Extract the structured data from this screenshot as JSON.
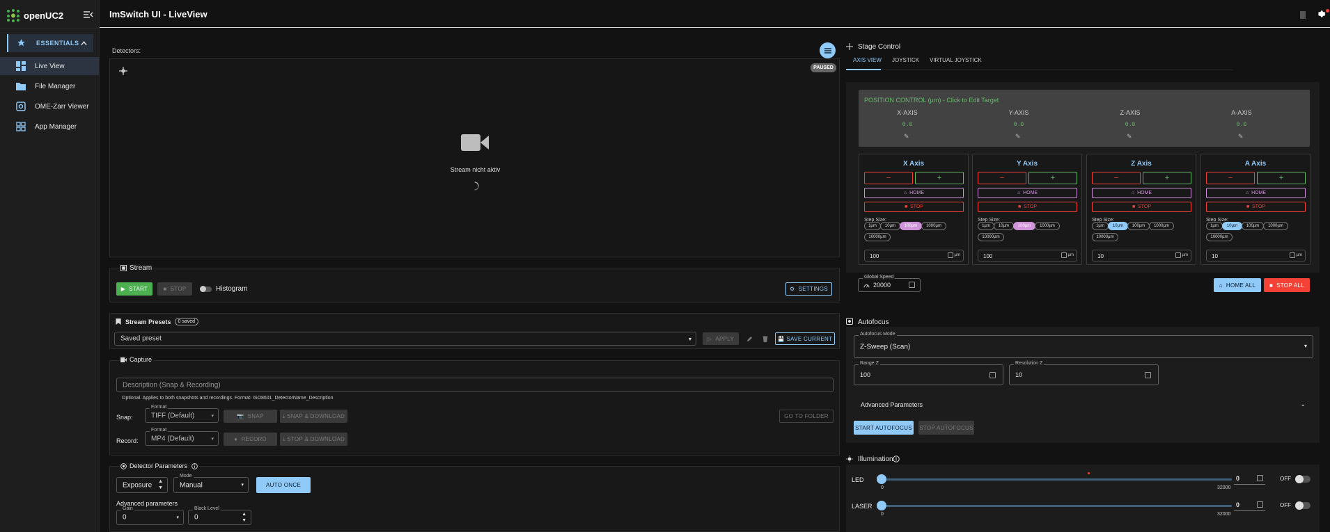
{
  "app": {
    "brand": "openUC2",
    "title": "ImSwitch UI - LiveView"
  },
  "sidebar": {
    "section_label": "ESSENTIALS",
    "items": [
      {
        "label": "Live View",
        "icon": "dashboard-icon",
        "active": true
      },
      {
        "label": "File Manager",
        "icon": "folder-icon",
        "active": false
      },
      {
        "label": "OME-Zarr Viewer",
        "icon": "zarr-icon",
        "active": false
      },
      {
        "label": "App Manager",
        "icon": "apps-icon",
        "active": false
      }
    ]
  },
  "liveview": {
    "detectors_label": "Detectors:",
    "paused_badge": "PAUSED",
    "stream_inactive": "Stream nicht aktiv"
  },
  "stream": {
    "title": "Stream",
    "start": "START",
    "stop": "STOP",
    "histogram": "Histogram",
    "settings": "SETTINGS"
  },
  "presets": {
    "title": "Stream Presets",
    "count": "0 saved",
    "placeholder": "Saved preset",
    "apply": "APPLY",
    "save_current": "SAVE CURRENT"
  },
  "capture": {
    "title": "Capture",
    "description_placeholder": "Description (Snap & Recording)",
    "hint": "Optional. Applies to both snapshots and recordings. Format: ISO8601_DetectorName_Description",
    "snap_label": "Snap:",
    "record_label": "Record:",
    "format_label": "Format",
    "snap_format": "TIFF (Default)",
    "record_format": "MP4 (Default)",
    "snap_btn": "SNAP",
    "snap_download": "SNAP & DOWNLOAD",
    "record_btn": "RECORD",
    "stop_download": "STOP & DOWNLOAD",
    "goto_folder": "GO TO FOLDER"
  },
  "detector_params": {
    "title": "Detector Parameters",
    "exposure": "Exposure",
    "mode_label": "Mode",
    "mode": "Manual",
    "auto_once": "AUTO ONCE",
    "advanced": "Advanced parameters",
    "gain_label": "Gain",
    "gain": "0",
    "black_label": "Black Level",
    "black": "0"
  },
  "stage": {
    "title": "Stage Control",
    "tabs": [
      "AXIS VIEW",
      "JOYSTICK",
      "VIRTUAL JOYSTICK"
    ],
    "position_title": "POSITION CONTROL (µm) - Click to Edit Target",
    "positions": [
      {
        "label": "X-AXIS",
        "value": "0.0"
      },
      {
        "label": "Y-AXIS",
        "value": "0.0"
      },
      {
        "label": "Z-AXIS",
        "value": "0.0"
      },
      {
        "label": "A-AXIS",
        "value": "0.0"
      }
    ],
    "axes": [
      {
        "title": "X Axis",
        "step": "100",
        "selected": 2,
        "color": "pink"
      },
      {
        "title": "Y Axis",
        "step": "100",
        "selected": 2,
        "color": "pink"
      },
      {
        "title": "Z Axis",
        "step": "10",
        "selected": 1,
        "color": "blue"
      },
      {
        "title": "A Axis",
        "step": "10",
        "selected": 1,
        "color": "blue"
      }
    ],
    "home": "HOME",
    "stop": "STOP",
    "step_size": "Step Size:",
    "chips": [
      "1µm",
      "10µm",
      "100µm",
      "1000µm",
      "10000µm"
    ],
    "unit": "µm",
    "minus": "−",
    "plus": "+",
    "global_speed_label": "Global Speed",
    "global_speed": "20000",
    "home_all": "HOME ALL",
    "stop_all": "STOP ALL"
  },
  "autofocus": {
    "title": "Autofocus",
    "mode_label": "Autofocus Mode",
    "mode": "Z-Sweep (Scan)",
    "range_label": "Range Z",
    "range": "100",
    "res_label": "Resolution Z",
    "res": "10",
    "advanced": "Advanced Parameters",
    "start": "START AUTOFOCUS",
    "stop": "STOP AUTOFOCUS"
  },
  "illumination": {
    "title": "Illumination",
    "channels": [
      {
        "name": "LED",
        "value": "0",
        "min": "0",
        "max": "32000",
        "state": "OFF"
      },
      {
        "name": "LASER",
        "value": "0",
        "min": "0",
        "max": "32000",
        "state": "OFF"
      }
    ]
  },
  "colors": {
    "accent": "#90caf9",
    "green": "#4caf50",
    "red": "#f44336",
    "pink": "#ce93d8"
  }
}
